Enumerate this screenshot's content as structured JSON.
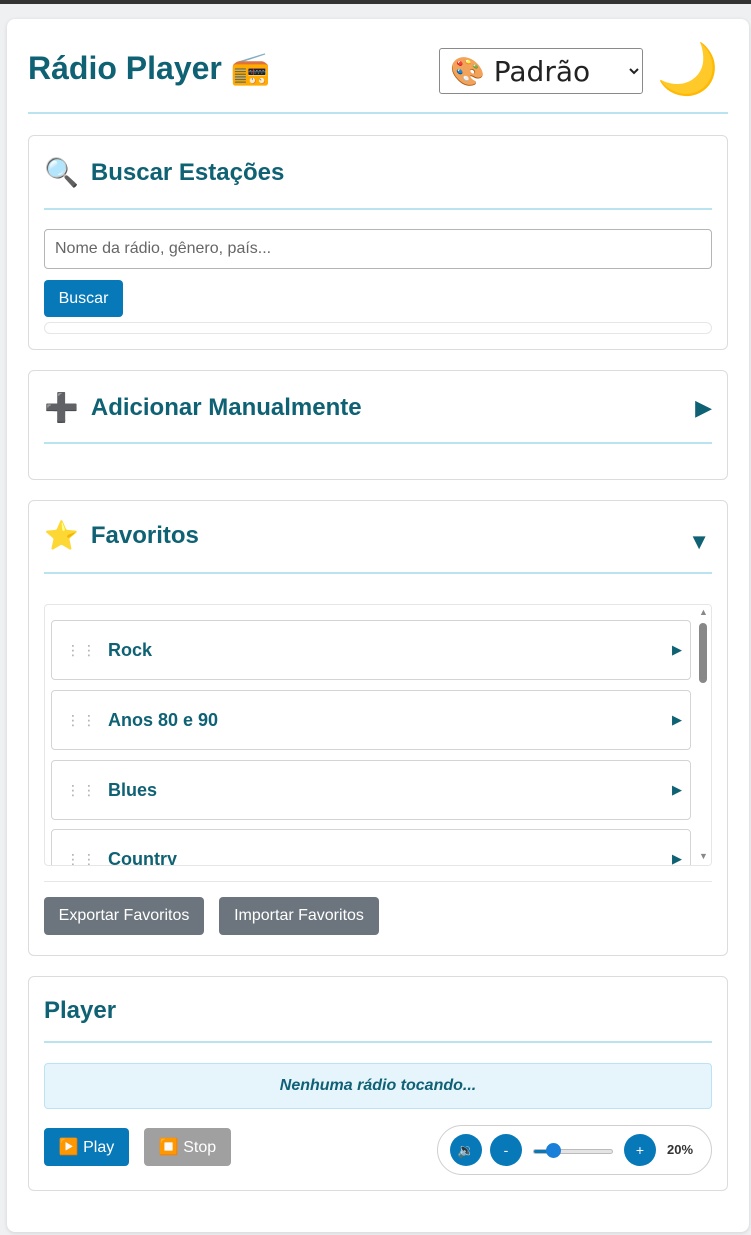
{
  "header": {
    "title": "Rádio Player 📻",
    "theme_selected": "🎨 Padrão",
    "dark_mode_icon": "🌙"
  },
  "search": {
    "icon": "🔍",
    "title": "Buscar Estações",
    "placeholder": "Nome da rádio, gênero, país...",
    "button_label": "Buscar"
  },
  "manual": {
    "icon": "➕",
    "title": "Adicionar Manualmente",
    "toggle": "▶"
  },
  "favorites": {
    "icon": "⭐",
    "title": "Favoritos",
    "toggle": "▼",
    "drag_glyph": "⋮⋮",
    "play_glyph": "▶",
    "items": [
      {
        "name": "Rock"
      },
      {
        "name": "Anos 80 e 90"
      },
      {
        "name": "Blues"
      },
      {
        "name": "Country"
      }
    ],
    "export_label": "Exportar Favoritos",
    "import_label": "Importar Favoritos"
  },
  "player": {
    "title": "Player",
    "now_playing": "Nenhuma rádio tocando...",
    "play_label": "▶️ Play",
    "stop_label": "⏹️ Stop",
    "mute_icon": "🔉",
    "vol_down": "-",
    "vol_up": "+",
    "volume": 20,
    "volume_label": "20%"
  },
  "colors": {
    "accent": "#0f6174",
    "primary": "#0779b9",
    "secondary": "#6c757d"
  }
}
